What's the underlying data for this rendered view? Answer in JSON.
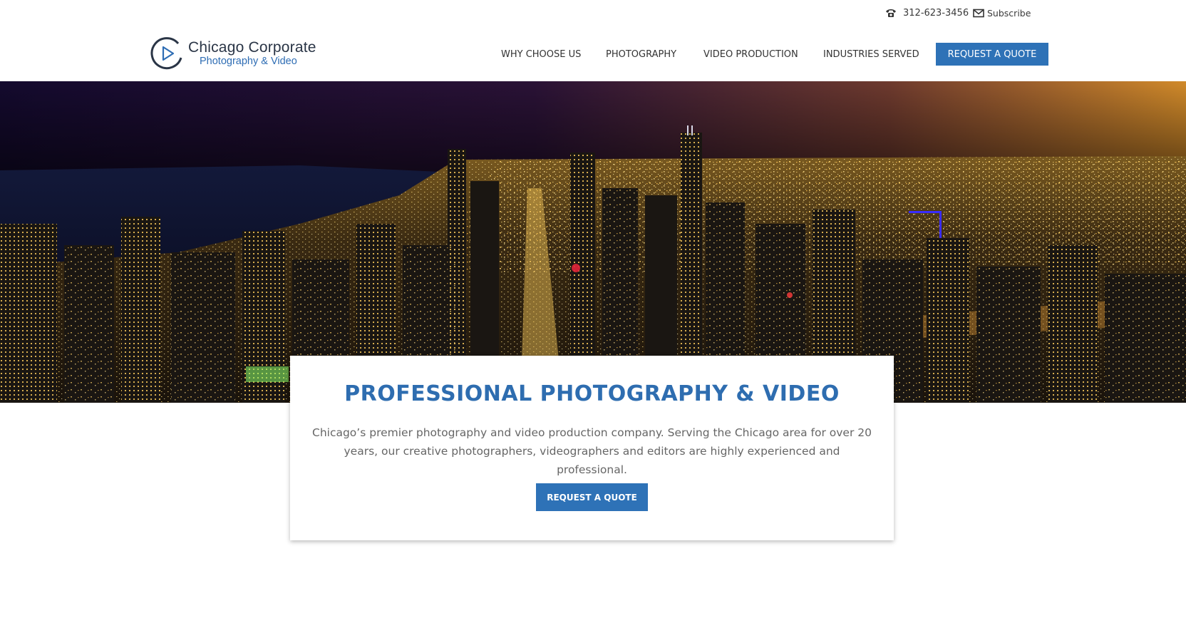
{
  "topbar": {
    "phone": "312-623-3456",
    "phone_icon": "phone-icon",
    "subscribe": "Subscribe",
    "subscribe_icon": "mail-icon"
  },
  "logo": {
    "line1": "Chicago Corporate",
    "line2": "Photography & Video",
    "icon": "play-icon"
  },
  "nav": {
    "items": [
      {
        "label": "WHY CHOOSE US"
      },
      {
        "label": "PHOTOGRAPHY"
      },
      {
        "label": "VIDEO PRODUCTION"
      },
      {
        "label": "INDUSTRIES SERVED"
      }
    ],
    "quote_label": "REQUEST A QUOTE"
  },
  "hero": {
    "title": "PROFESSIONAL PHOTOGRAPHY & VIDEO",
    "body": "Chicago’s premier photography and video production company. Serving the Chicago area for over 20 years, our creative photographers, videographers and editors are highly experienced and professional.",
    "cta_label": "REQUEST A QUOTE"
  },
  "colors": {
    "accent": "#2e72b7",
    "title": "#2e6db0",
    "logo_dark": "#2a3546",
    "body_text": "#666666"
  }
}
